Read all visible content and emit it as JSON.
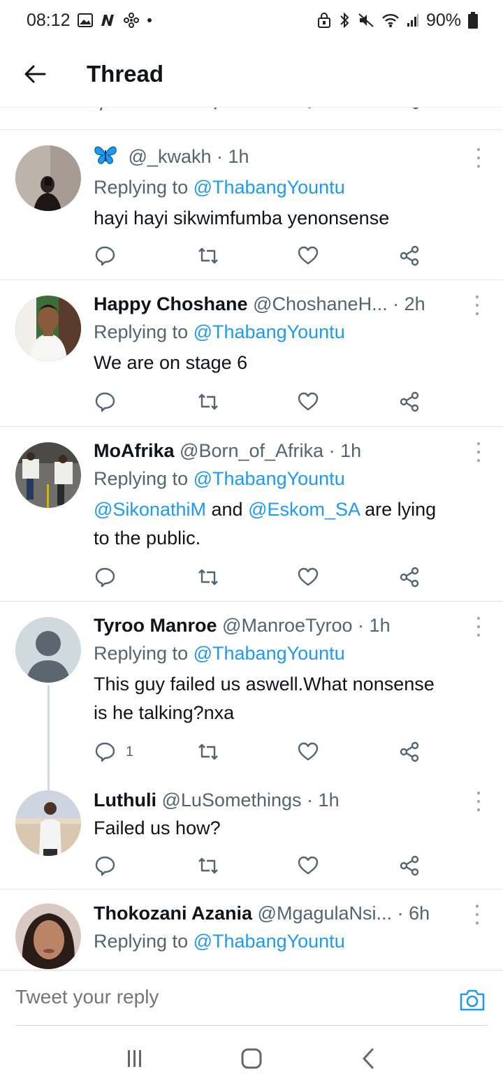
{
  "status_bar": {
    "time": "08:12",
    "battery": "90%"
  },
  "header": {
    "title": "Thread",
    "back_icon": "arrow-left-icon"
  },
  "colors": {
    "link": "#1d9bf0",
    "muted": "#536471",
    "divider": "#e6e6e6"
  },
  "tweets": [
    {
      "display_name": "",
      "emoji_icon": "butterfly-icon",
      "handle": "@_kwakh",
      "time": "1h",
      "replying_prefix": "Replying to",
      "replying_to": "@ThabangYountu",
      "text": "hayi hayi sikwimfumba yenonsense"
    },
    {
      "display_name": "Happy Choshane",
      "handle": "@ChoshaneH...",
      "time": "2h",
      "replying_prefix": "Replying to",
      "replying_to": "@ThabangYountu",
      "text": "We are on stage 6"
    },
    {
      "display_name": "MoAfrika",
      "handle": "@Born_of_Afrika",
      "time": "1h",
      "replying_prefix": "Replying to",
      "replying_to": "@ThabangYountu",
      "mention_1": "@SikonathiM",
      "conj": "and",
      "mention_2": "@Eskom_SA",
      "text_after": "are lying",
      "text_line2": "to the public."
    },
    {
      "display_name": "Tyroo Manroe",
      "handle": "@ManroeTyroo",
      "time": "1h",
      "replying_prefix": "Replying to",
      "replying_to": "@ThabangYountu",
      "text_line1": "This guy failed us aswell.What nonsense",
      "text_line2": "is he talking?nxa",
      "reply_count": "1"
    },
    {
      "display_name": "Luthuli",
      "handle": "@LuSomethings",
      "time": "1h",
      "text": "Failed us how?"
    },
    {
      "display_name": "Thokozani Azania",
      "handle": "@MgagulaNsi...",
      "time": "6h",
      "replying_prefix": "Replying to",
      "replying_to": "@ThabangYountu"
    }
  ],
  "reply_bar": {
    "placeholder": "Tweet your reply",
    "camera_icon": "camera-icon"
  },
  "nav_bar": {
    "recents_icon": "recents-icon",
    "home_icon": "home-icon",
    "back_icon": "nav-back-icon"
  }
}
